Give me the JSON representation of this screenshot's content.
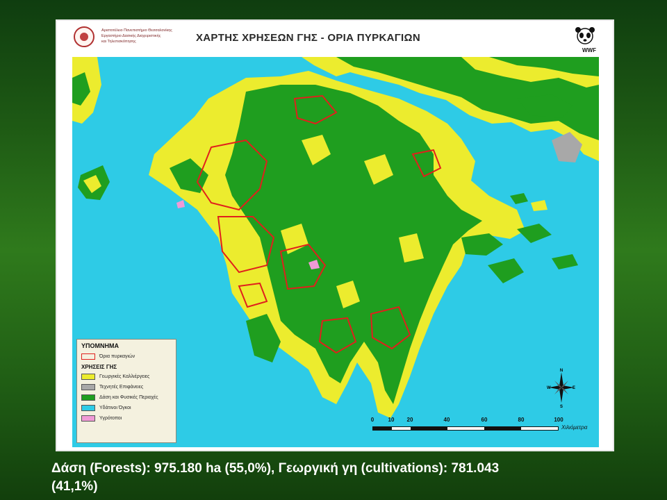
{
  "map": {
    "institution_lines": [
      "Αριστοτέλειο Πανεπιστήμιο Θεσσαλονίκης",
      "Εργαστήριο Δασικής Διαχειριστικής",
      "και Τηλεπισκόπησης"
    ],
    "title": "ΧΑΡΤΗΣ ΧΡΗΣΕΩΝ ΓΗΣ - ΟΡΙΑ ΠΥΡΚΑΓΙΩΝ",
    "logo_text": "WWF",
    "legend": {
      "title": "ΥΠΟΜΝΗΜΑ",
      "fire_boundary_label": "Όρια πυρκαγιών",
      "section_title": "ΧΡΗΣΕΙΣ ΓΗΣ",
      "items": [
        {
          "label": "Γεωργικές Καλλιέργειες",
          "color": "#ecec2e"
        },
        {
          "label": "Τεχνητές Επιφάνειες",
          "color": "#a8a8a8"
        },
        {
          "label": "Δάση και Φυσικές Περιοχές",
          "color": "#1f9e1f"
        },
        {
          "label": "Υδάτινοι Όγκοι",
          "color": "#2ecbe6"
        },
        {
          "label": "Υγρότοποι",
          "color": "#f09ad6"
        }
      ]
    },
    "compass": {
      "n": "N",
      "s": "S",
      "e": "E",
      "w": "W"
    },
    "scale": {
      "ticks": [
        "0",
        "10",
        "20",
        "40",
        "60",
        "80",
        "100"
      ],
      "unit": "Χιλιόμετρα"
    }
  },
  "caption": {
    "line1": "Δάση (Forests): 975.180 ha (55,0%), Γεωργική γη (cultivations): 781.043",
    "line2": "(41,1%)"
  }
}
